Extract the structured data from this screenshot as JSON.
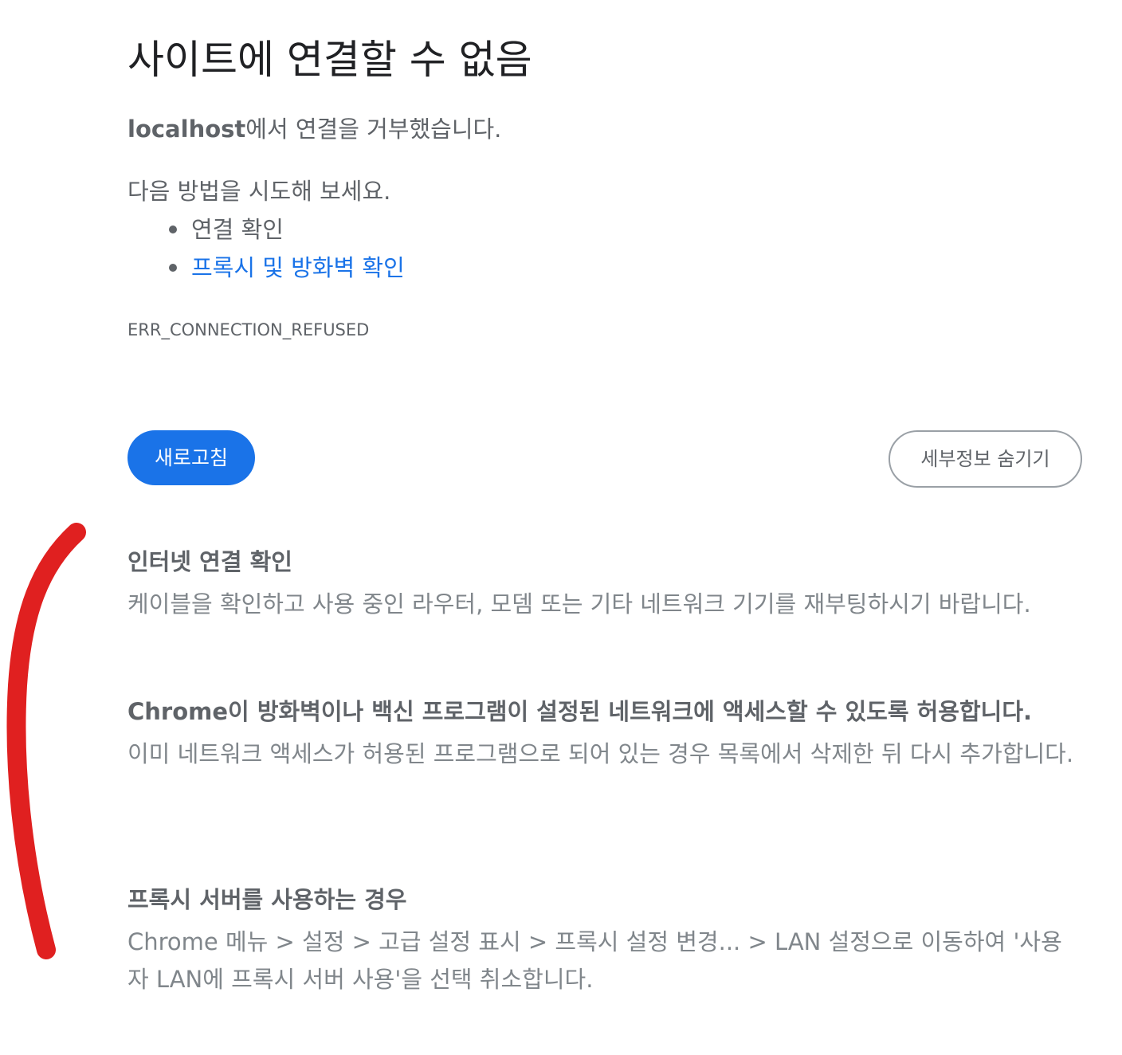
{
  "page": {
    "title": "사이트에 연결할 수 없음",
    "summary_host": "localhost",
    "summary_text": "에서 연결을 거부했습니다.",
    "suggestions_intro": "다음 방법을 시도해 보세요.",
    "suggestions": [
      {
        "label": "연결 확인",
        "is_link": false
      },
      {
        "label": "프록시 및 방화벽 확인",
        "is_link": true
      }
    ],
    "error_code": "ERR_CONNECTION_REFUSED"
  },
  "buttons": {
    "reload_label": "새로고침",
    "details_label": "세부정보 숨기기"
  },
  "details": [
    {
      "heading": "인터넷 연결 확인",
      "body": "케이블을 확인하고 사용 중인 라우터, 모뎀 또는 기타 네트워크 기기를 재부팅하시기 바랍니다."
    },
    {
      "heading": "Chrome이 방화벽이나 백신 프로그램이 설정된 네트워크에 액세스할 수 있도록 허용합니다.",
      "body": "이미 네트워크 액세스가 허용된 프로그램으로 되어 있는 경우 목록에서 삭제한 뒤 다시 추가합니다."
    },
    {
      "heading": "프록시 서버를 사용하는 경우",
      "body": "Chrome 메뉴 > 설정 > 고급 설정 표시 > 프록시 설정 변경... > LAN 설정으로 이동하여 '사용자 LAN에 프록시 서버 사용'을 선택 취소합니다."
    }
  ],
  "colors": {
    "accent": "#1a73e8",
    "text_primary": "#202124",
    "text_secondary": "#5f6368",
    "annotation_stroke": "#e02020"
  }
}
